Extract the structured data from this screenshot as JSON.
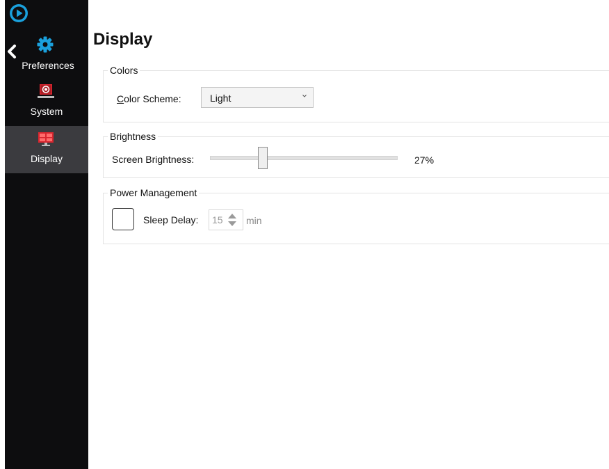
{
  "sidebar": {
    "logo_icon": "play-circle-icon",
    "back_icon": "chevron-left-icon",
    "header_icon": "gear-icon",
    "header_label": "Preferences",
    "items": [
      {
        "label": "System",
        "icon": "monitor-record-icon",
        "active": false
      },
      {
        "label": "Display",
        "icon": "display-icon",
        "active": true
      }
    ]
  },
  "page": {
    "title": "Display"
  },
  "colors": {
    "group_title": "Colors",
    "scheme_label_accel": "C",
    "scheme_label_rest": "olor Scheme:",
    "scheme_value": "Light"
  },
  "brightness": {
    "group_title": "Brightness",
    "label": "Screen Brightness:",
    "value": 27,
    "value_text": "27%"
  },
  "power": {
    "group_title": "Power Management",
    "sleep_enabled": false,
    "sleep_label": "Sleep Delay:",
    "sleep_value": "15",
    "unit": "min"
  },
  "theme": {
    "accent": "#1aa0dc",
    "sidebar_bg": "#0d0d0f",
    "active_item_bg": "#3b3b3f",
    "icon_red": "#d7262f"
  }
}
